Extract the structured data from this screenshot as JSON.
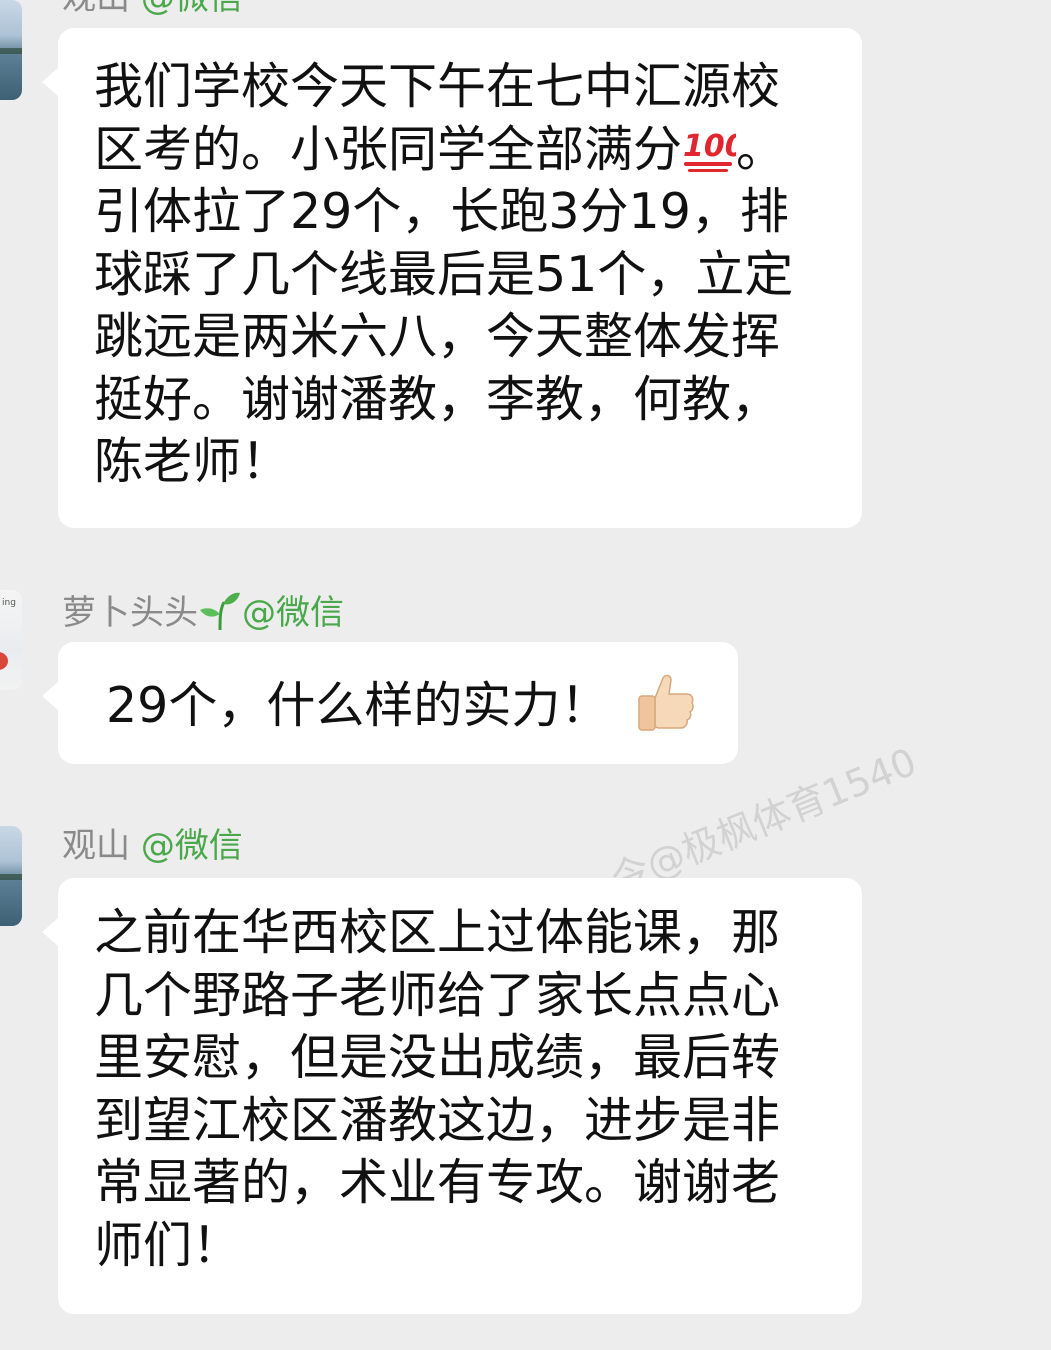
{
  "messages": [
    {
      "sender_name": "观山",
      "sender_suffix": "@微信",
      "text_part1": "我们学校今天下午在七中汇源校区考的。小张同学全部满分",
      "emoji": "100-points-emoji",
      "text_part2": "。引体拉了29个，长跑3分19，排球踩了几个线最后是51个，立定跳远是两米六八，今天整体发挥挺好。谢谢潘教，李教，何教，陈老师！"
    },
    {
      "sender_name": "萝卜头头",
      "sender_icon": "seedling-icon",
      "sender_suffix": "@微信",
      "text": "29个，什么样的实力！",
      "emoji": "thumbs-up-emoji"
    },
    {
      "sender_name": "观山",
      "sender_suffix": "@微信",
      "text": "之前在华西校区上过体能课，那几个野路子老师给了家长点点心里安慰，但是没出成绩，最后转到望江校区潘教这边，进步是非常显著的，术业有专攻。谢谢老师们！"
    }
  ],
  "watermark": "今@极枫体育1540",
  "colors": {
    "background": "#ededed",
    "bubble": "#ffffff",
    "sender_name": "#8a8a8a",
    "wechat_tag": "#49a84a"
  }
}
